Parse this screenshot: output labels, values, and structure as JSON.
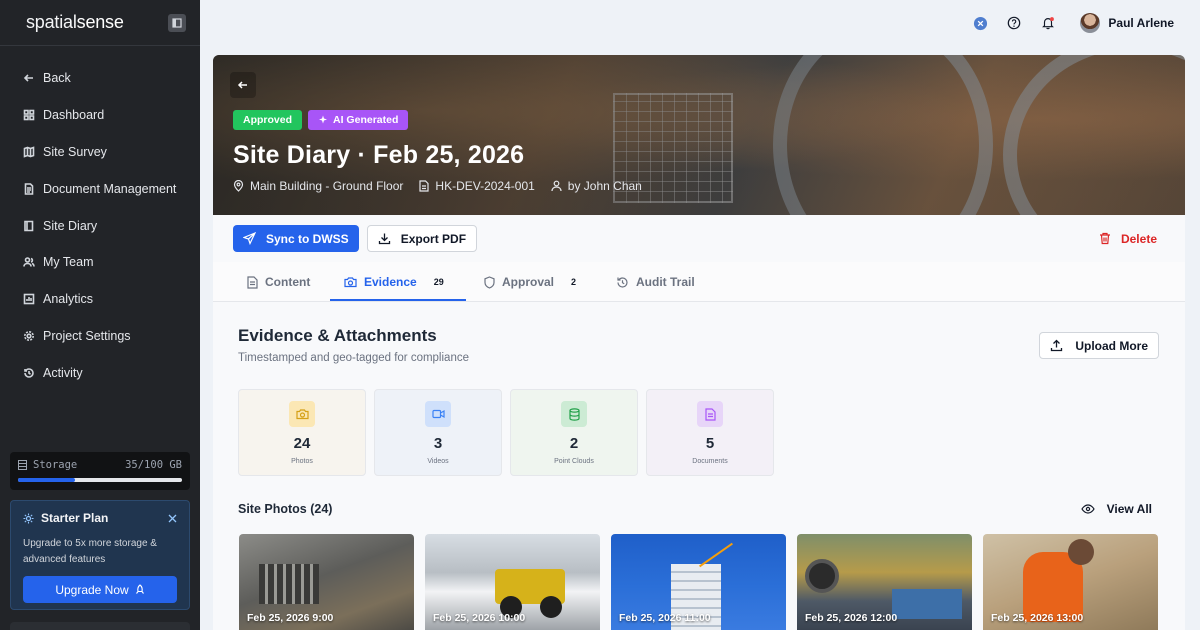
{
  "sidebar": {
    "brand_regular": "spatial",
    "brand_bold": "sense",
    "items": [
      {
        "label": "Back",
        "icon": "arrow-left-icon"
      },
      {
        "label": "Dashboard",
        "icon": "grid-icon"
      },
      {
        "label": "Site Survey",
        "icon": "map-icon"
      },
      {
        "label": "Document Management",
        "icon": "document-icon"
      },
      {
        "label": "Site Diary",
        "icon": "book-icon"
      },
      {
        "label": "My Team",
        "icon": "users-icon"
      },
      {
        "label": "Analytics",
        "icon": "chart-icon"
      },
      {
        "label": "Project Settings",
        "icon": "gear-icon"
      },
      {
        "label": "Activity",
        "icon": "history-icon"
      }
    ],
    "storage": {
      "label": "Storage",
      "value": "35/100 GB",
      "fraction": 0.35
    },
    "plan": {
      "title": "Starter Plan",
      "description": "Upgrade to 5x more storage & advanced features",
      "button": "Upgrade Now"
    }
  },
  "topbar": {
    "user_name": "Paul Arlene"
  },
  "hero": {
    "badges": [
      "Approved",
      "AI Generated"
    ],
    "title": "Site Diary · Feb 25, 2026",
    "location": "Main Building - Ground Floor",
    "doc_id": "HK-DEV-2024-001",
    "author": "by John Chan"
  },
  "actions": {
    "sync": "Sync to DWSS",
    "export": "Export PDF",
    "delete": "Delete"
  },
  "tabs": [
    {
      "label": "Content",
      "count": "",
      "active": false
    },
    {
      "label": "Evidence",
      "count": "29",
      "active": true
    },
    {
      "label": "Approval",
      "count": "2",
      "active": false
    },
    {
      "label": "Audit Trail",
      "count": "",
      "active": false
    }
  ],
  "evidence": {
    "title": "Evidence & Attachments",
    "subtitle": "Timestamped and geo-tagged for compliance",
    "upload": "Upload More",
    "stats": [
      {
        "value": "24",
        "label": "Photos",
        "color": "#eab308"
      },
      {
        "value": "3",
        "label": "Videos",
        "color": "#3b82f6"
      },
      {
        "value": "2",
        "label": "Point Clouds",
        "color": "#22c55e"
      },
      {
        "value": "5",
        "label": "Documents",
        "color": "#a855f7"
      }
    ],
    "photos_title": "Site Photos (24)",
    "view_all": "View All",
    "photos": [
      {
        "caption": "Feb 25, 2026 9:00"
      },
      {
        "caption": "Feb 25, 2026 10:00"
      },
      {
        "caption": "Feb 25, 2026 11:00"
      },
      {
        "caption": "Feb 25, 2026 12:00"
      },
      {
        "caption": "Feb 25, 2026 13:00"
      }
    ]
  }
}
